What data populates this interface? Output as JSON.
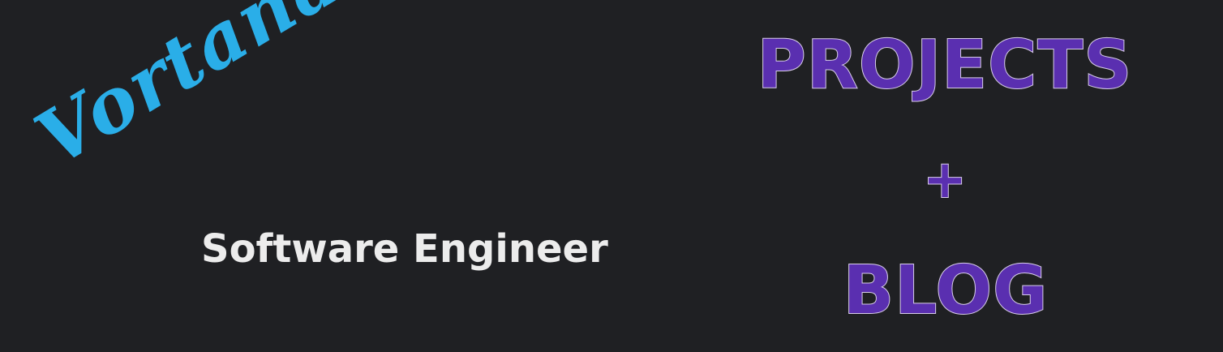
{
  "banner": {
    "name": "Vortana Say",
    "role": "Software Engineer",
    "links": {
      "projects": "Projects",
      "plus": "+",
      "blog": "Blog"
    }
  },
  "colors": {
    "background": "#1f2023",
    "name": "#2aaee8",
    "role": "#ececec",
    "accent": "#5a2fb0",
    "accent_outline": "#d8cde9"
  }
}
